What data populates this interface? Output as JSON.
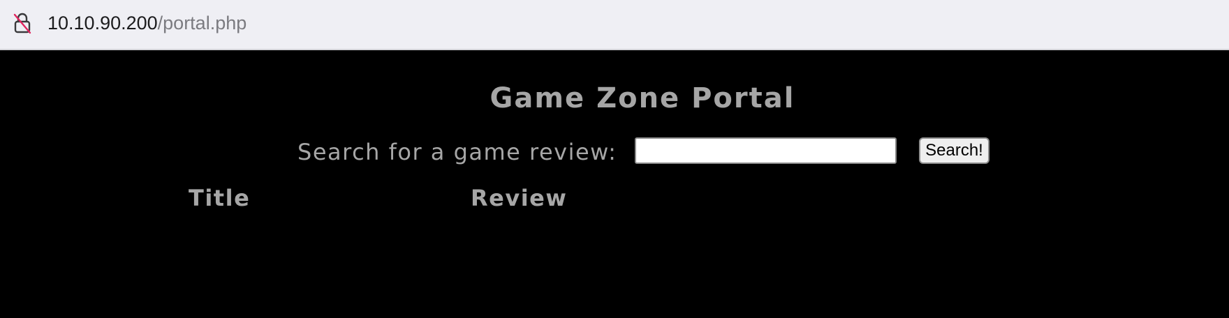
{
  "browser": {
    "url_host": "10.10.90.200",
    "url_path": "/portal.php",
    "security_icon": "insecure-lock-icon"
  },
  "page": {
    "title": "Game Zone Portal",
    "search": {
      "label": "Search for a game review:",
      "value": "",
      "placeholder": "",
      "button_label": "Search!"
    },
    "table": {
      "columns": [
        "Title",
        "Review"
      ],
      "rows": []
    }
  },
  "colors": {
    "page_background": "#000000",
    "text": "#a6a6a6",
    "address_bar": "#efeff4",
    "insecure_slash": "#e0245e"
  }
}
